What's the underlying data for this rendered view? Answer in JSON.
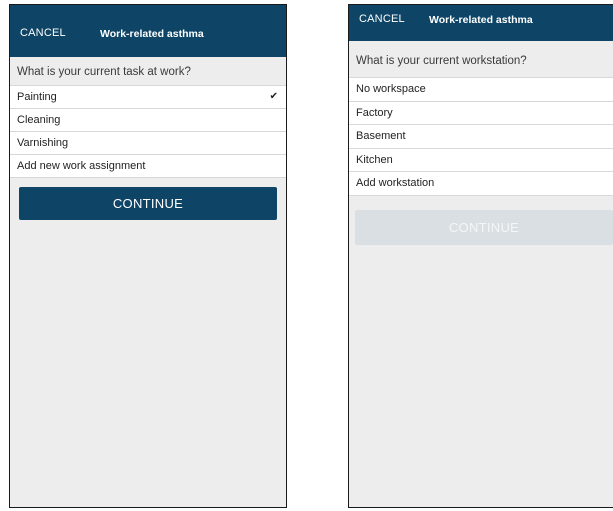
{
  "left_screen": {
    "header": {
      "cancel_label": "CANCEL",
      "title": "Work-related asthma"
    },
    "question": "What is your current task at work?",
    "items": [
      {
        "label": "Painting",
        "selected": true
      },
      {
        "label": "Cleaning",
        "selected": false
      },
      {
        "label": "Varnishing",
        "selected": false
      },
      {
        "label": "Add new work assignment",
        "selected": false
      }
    ],
    "check_mark": "✔",
    "continue_label": "CONTINUE",
    "continue_enabled": true
  },
  "right_screen": {
    "header": {
      "cancel_label": "CANCEL",
      "title": "Work-related asthma"
    },
    "question": "What is your current workstation?",
    "items": [
      {
        "label": "No workspace"
      },
      {
        "label": "Factory"
      },
      {
        "label": "Basement"
      },
      {
        "label": "Kitchen"
      },
      {
        "label": "Add workstation"
      }
    ],
    "continue_label": "CONTINUE",
    "continue_enabled": false
  },
  "colors": {
    "header_bg": "#0e4567",
    "screen_bg": "#ededed",
    "button_disabled_bg": "#dadfe3"
  }
}
